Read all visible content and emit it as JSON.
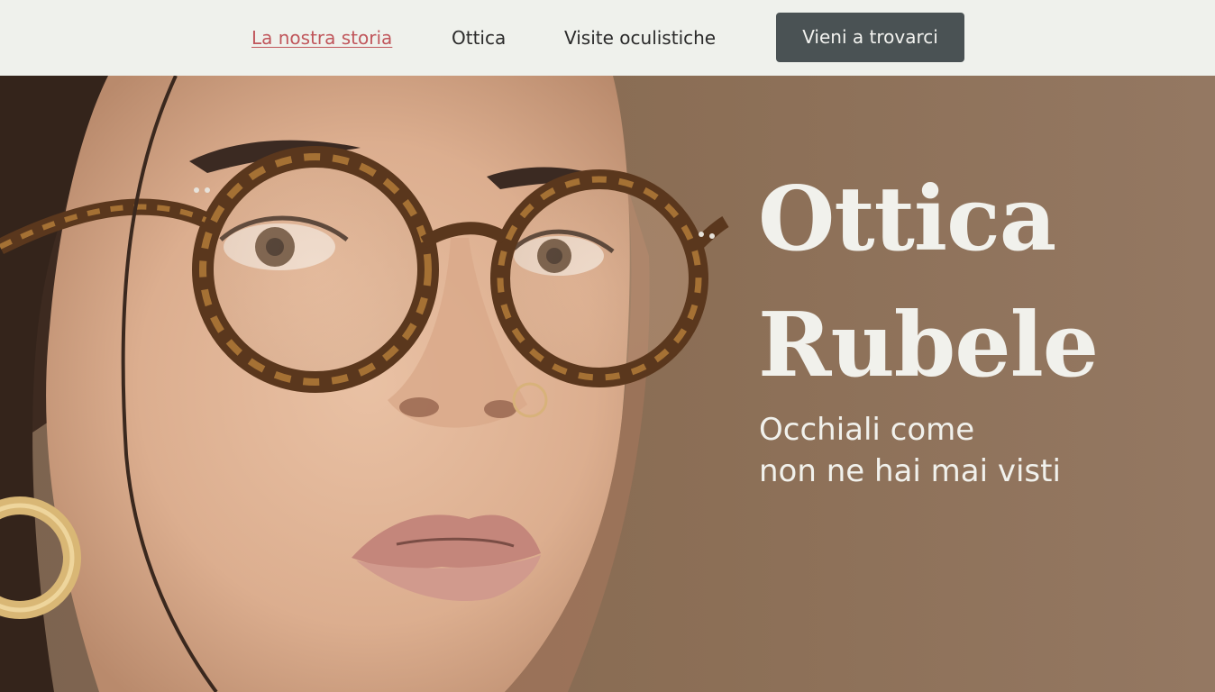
{
  "nav": {
    "links": [
      {
        "label": "La nostra storia",
        "active": true
      },
      {
        "label": "Ottica",
        "active": false
      },
      {
        "label": "Visite oculistiche",
        "active": false
      }
    ],
    "cta_label": "Vieni a trovarci"
  },
  "hero": {
    "title_line1": "Ottica",
    "title_line2": "Rubele",
    "subtitle_line1": "Occhiali come",
    "subtitle_line2": "non ne hai mai visti",
    "image": "portrait-woman-glasses"
  },
  "colors": {
    "background": "#eff1ec",
    "accent": "#c0565b",
    "button": "#4a5254",
    "hero_text": "#f1f1ec",
    "hero_bg": "#8e7259"
  }
}
